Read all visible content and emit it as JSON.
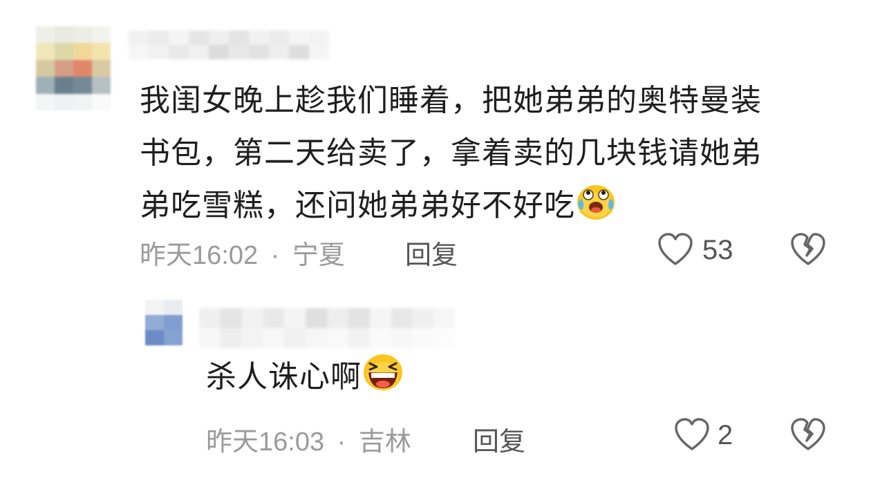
{
  "comments": [
    {
      "text_lines": [
        "我闺女晚上趁我们睡着，把她弟弟的奥特曼装",
        "书包，第二天给卖了，拿着卖的几块钱请她弟",
        "弟吃雪糕，还问她弟弟好不好吃"
      ],
      "emoji": "crying-laughing-emoji",
      "time": "昨天16:02",
      "separator": "·",
      "location": "宁夏",
      "reply_label": "回复",
      "like_count": "53"
    },
    {
      "text": "杀人诛心啊",
      "emoji": "laughing-emoji",
      "time": "昨天16:03",
      "separator": "·",
      "location": "吉林",
      "reply_label": "回复",
      "like_count": "2"
    }
  ],
  "icons": {
    "like": "heart-outline-icon",
    "dislike": "broken-heart-icon"
  },
  "colors": {
    "text": "#1e1e1e",
    "meta": "#9a9a9a",
    "icon": "#666666",
    "emoji_yellow": "#f9c51f"
  }
}
